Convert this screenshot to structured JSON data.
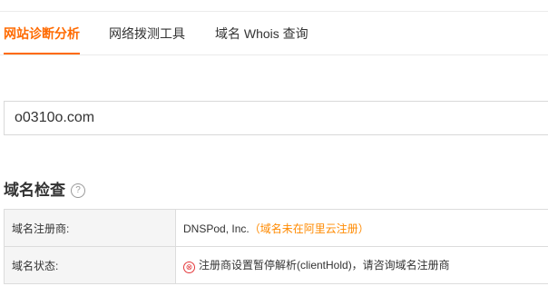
{
  "tabs": [
    {
      "label": "网站诊断分析",
      "active": true
    },
    {
      "label": "网络拨测工具",
      "active": false
    },
    {
      "label": "域名 Whois 查询",
      "active": false
    }
  ],
  "search": {
    "value": "o0310o.com"
  },
  "domain_check": {
    "title": "域名检查",
    "help_icon": "?",
    "rows": [
      {
        "label": "域名注册商:",
        "value": "DNSPod, Inc.",
        "note": "（域名未在阿里云注册）"
      },
      {
        "label": "域名状态:",
        "icon": "⊗",
        "value": "注册商设置暂停解析(clientHold)，请咨询域名注册商"
      }
    ]
  },
  "colors": {
    "accent": "#ff6a00",
    "note": "#ff8a00",
    "error": "#e4393c",
    "label_bg": "#f5f5f5"
  }
}
